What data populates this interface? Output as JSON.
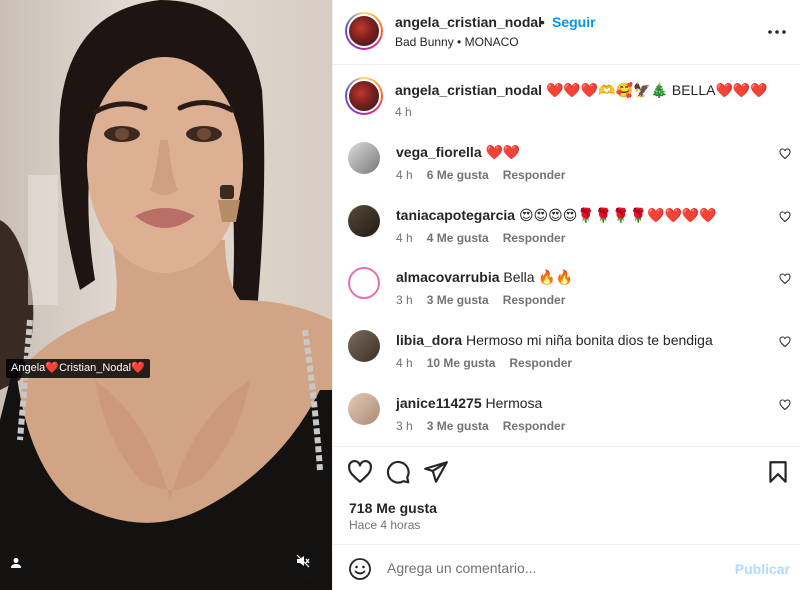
{
  "post": {
    "photo_tag": "Angela❤️Cristian_Nodal❤️",
    "author": "angela_cristian_nodal",
    "follow_label": "Seguir",
    "separator": "•",
    "audio": "Bad Bunny • MONACO",
    "caption": {
      "username": "angela_cristian_nodal",
      "text": " ❤️❤️❤️🫶🥰🦅🎄 BELLA❤️❤️❤️",
      "time": "4 h"
    },
    "likes": "718 Me gusta",
    "posted": "Hace 4 horas"
  },
  "comments": [
    {
      "username": "vega_fiorella",
      "text": " ❤️❤️",
      "time": "4 h",
      "likes": "6 Me gusta",
      "reply": "Responder"
    },
    {
      "username": "taniacapotegarcia",
      "text": " 😍😍😍😍🌹🌹🌹🌹❤️❤️❤️❤️",
      "time": "4 h",
      "likes": "4 Me gusta",
      "reply": "Responder"
    },
    {
      "username": "almacovarrubia",
      "text": " Bella 🔥🔥",
      "time": "3 h",
      "likes": "3 Me gusta",
      "reply": "Responder"
    },
    {
      "username": "libia_dora",
      "text": " Hermoso mi niña bonita dios te bendiga",
      "time": "4 h",
      "likes": "10 Me gusta",
      "reply": "Responder"
    },
    {
      "username": "janice114275",
      "text": " Hermosa",
      "time": "3 h",
      "likes": "3 Me gusta",
      "reply": "Responder"
    }
  ],
  "composer": {
    "placeholder": "Agrega un comentario...",
    "publish_label": "Publicar"
  },
  "colors": {
    "accent": "#0095f6",
    "publish_disabled": "#b3dbff",
    "secondary_text": "#737373"
  },
  "icons": [
    "more-options-icon",
    "heart-icon",
    "comment-icon",
    "share-icon",
    "bookmark-icon",
    "emoji-icon",
    "user-tag-icon",
    "mute-icon"
  ]
}
